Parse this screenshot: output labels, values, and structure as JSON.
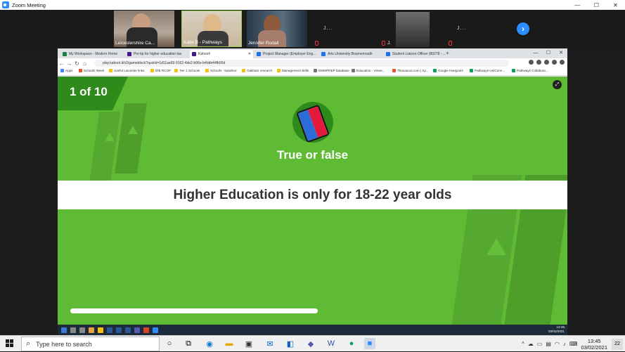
{
  "zoom": {
    "title": "Zoom Meeting",
    "min": "—",
    "max": "☐",
    "close": "✕"
  },
  "participants": [
    {
      "name": "Leicestershire Ca..."
    },
    {
      "name": "Katie B - Pathways"
    },
    {
      "name": "Jennifer Rodall"
    },
    {
      "name": "J..."
    },
    {
      "name": "J."
    },
    {
      "name": "J..."
    }
  ],
  "gallery": {
    "next": "›"
  },
  "browser": {
    "tabs": [
      {
        "label": "My Workspace - Modern Home",
        "color": "#1a7f3f"
      },
      {
        "label": "Pre tip for higher education tas",
        "color": "#46178f"
      },
      {
        "label": "Kahoot!",
        "color": "#46178f"
      },
      {
        "label": "Project Manager (Employer Eng...",
        "color": "#1a73e8"
      },
      {
        "label": "Arts University Bournemouth",
        "color": "#1a73e8"
      },
      {
        "label": "Student Liaison Officer (80278 - ...",
        "color": "#1a73e8"
      }
    ],
    "newtab": "+",
    "url": "play.kahoot.it/v2/gameblock?quizId=1d11ae65-9162-4de2-b96e-b4bbb44fb95d",
    "bookmarks": [
      {
        "label": "Apps",
        "color": "#4285f4"
      },
      {
        "label": "Schools Week",
        "color": "#e8542e"
      },
      {
        "label": "Useful Leicester links",
        "color": "#f4c20d"
      },
      {
        "label": "DfE RCOP",
        "color": "#f4c20d"
      },
      {
        "label": "Tier 1 Schools",
        "color": "#f4c20d"
      },
      {
        "label": "Schools - baseline",
        "color": "#f4c20d"
      },
      {
        "label": "Oakham research",
        "color": "#f4c20d"
      },
      {
        "label": "Management skills",
        "color": "#f4c20d"
      },
      {
        "label": "EMWPREP database",
        "color": "#777777"
      },
      {
        "label": "Education - Views...",
        "color": "#777777"
      },
      {
        "label": "Thesaurus.com | Sy...",
        "color": "#e8542e"
      },
      {
        "label": "Google Hangouts",
        "color": "#0f9d58"
      },
      {
        "label": "Pathways-UniConn...",
        "color": "#0f9d58"
      },
      {
        "label": "Pathways Collabora...",
        "color": "#0f9d58"
      }
    ]
  },
  "kahoot": {
    "counter": "1 of 10",
    "question_type": "True or false",
    "question": "Higher Education is only for 18-22 year olds",
    "time_remaining": 0.485
  },
  "mini_clock": {
    "time": "13:45",
    "date": "03/02/2021"
  },
  "taskbar": {
    "search_placeholder": "Type here to search",
    "time": "13:45",
    "date": "03/02/2021",
    "notifications": "22"
  }
}
